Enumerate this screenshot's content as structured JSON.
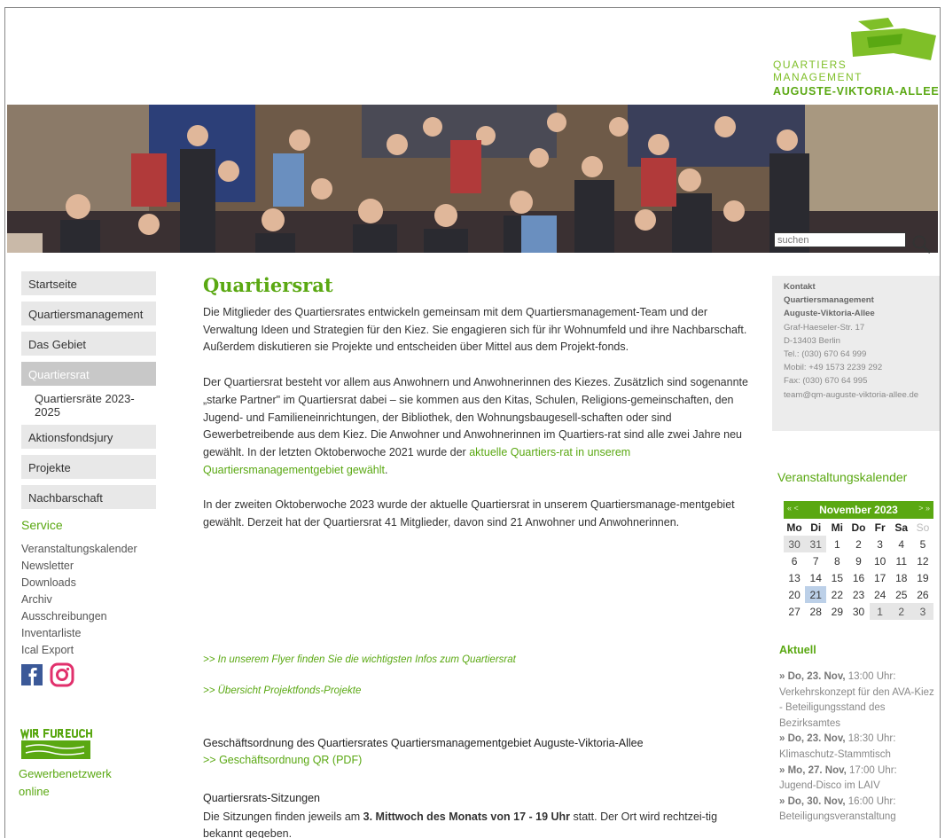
{
  "header": {
    "logo_line1": "QUARTIERS",
    "logo_line2": "MANAGEMENT",
    "logo_line3": "AUGUSTE-VIKTORIA-ALLEE",
    "search_placeholder": "suchen"
  },
  "nav": {
    "items": [
      {
        "label": "Startseite"
      },
      {
        "label": "Quartiersmanagement"
      },
      {
        "label": "Das Gebiet"
      },
      {
        "label": "Quartiersrat"
      },
      {
        "label": "Aktionsfondsjury"
      },
      {
        "label": "Projekte"
      },
      {
        "label": "Nachbarschaft"
      }
    ],
    "sub_item": "Quartiersräte 2023-2025"
  },
  "service": {
    "title": "Service",
    "links": [
      "Veranstaltungskalender",
      "Newsletter",
      "Downloads",
      "Archiv",
      "Ausschreibungen",
      "Inventarliste",
      "Ical Export"
    ],
    "gewerbe_line1": "Gewerbenetzwerk",
    "gewerbe_line2": "online"
  },
  "main": {
    "title": "Quartiersrat",
    "p1": "Die Mitglieder des Quartiersrates entwickeln gemeinsam mit dem Quartiersmanagement-Team und der Verwaltung Ideen und Strategien für den Kiez. Sie engagieren sich für ihr Wohnumfeld und ihre Nachbarschaft. Außerdem diskutieren sie Projekte und entscheiden über Mittel aus dem Projekt-fonds.",
    "p2_text": "Der Quartiersrat besteht vor allem aus Anwohnern und Anwohnerinnen des Kiezes. Zusätzlich sind sogenannte „starke Partner\" im Quartiersrat dabei – sie kommen aus den Kitas, Schulen, Religions-gemeinschaften, den Jugend- und Familieneinrichtungen, der Bibliothek, den Wohnungsbaugesell-schaften oder sind Gewerbetreibende aus dem Kiez. Die Anwohner und Anwohnerinnen im Quartiers-rat sind alle zwei Jahre neu gewählt. In der letzten Oktoberwoche 2021 wurde der ",
    "p2_link": "aktuelle Quartiers-rat in unserem Quartiersmanagementgebiet gewählt",
    "p2_end": ".",
    "p3": "In der zweiten Oktoberwoche 2023 wurde der aktuelle Quartiersrat in unserem Quartiersmanage-mentgebiet gewählt. Derzeit hat der Quartiersrat 41 Mitglieder, davon sind 21 Anwohner und Anwohnerinnen.",
    "flyer_link": ">> In unserem Flyer finden Sie die wichtigsten Infos zum Quartiersrat",
    "projects_link": ">> Übersicht Projektfonds-Projekte",
    "gesch_title": "Geschäftsordnung des Quartiersrates Quartiersmanagementgebiet Auguste-Viktoria-Allee",
    "gesch_link": ">> Geschäftsordnung QR (PDF)",
    "sitz_title": "Quartiersrats-Sitzungen",
    "sitz_pre": "Die Sitzungen finden jeweils am ",
    "sitz_bold": "3. Mittwoch des Monats von 17 - 19 Uhr",
    "sitz_post": " statt. Der Ort wird rechtzei-tig bekannt gegeben."
  },
  "contact": {
    "title": "Kontakt",
    "org1": "Quartiersmanagement",
    "org2": "Auguste-Viktoria-Allee",
    "street": "Graf-Haeseler-Str. 17",
    "city": "D-13403 Berlin",
    "tel": "Tel.: (030) 670 64 999",
    "mobil": "Mobil: +49 1573 2239 292",
    "fax": "Fax: (030) 670 64 995",
    "email": "team@qm-auguste-viktoria-allee.de"
  },
  "calendar": {
    "title": "Veranstaltungskalender",
    "prev": "« <",
    "next": "> »",
    "month": "November 2023",
    "weekdays": [
      "Mo",
      "Di",
      "Mi",
      "Do",
      "Fr",
      "Sa",
      "So"
    ],
    "weeks": [
      [
        "30",
        "31",
        "1",
        "2",
        "3",
        "4",
        "5"
      ],
      [
        "6",
        "7",
        "8",
        "9",
        "10",
        "11",
        "12"
      ],
      [
        "13",
        "14",
        "15",
        "16",
        "17",
        "18",
        "19"
      ],
      [
        "20",
        "21",
        "22",
        "23",
        "24",
        "25",
        "26"
      ],
      [
        "27",
        "28",
        "29",
        "30",
        "1",
        "2",
        "3"
      ]
    ]
  },
  "aktuell": {
    "title": "Aktuell",
    "events": [
      {
        "date": "» Do, 23. Nov,",
        "time": " 13:00 Uhr:",
        "text": "Verkehrskonzept für den AVA-Kiez - Beteiligungsstand des Bezirksamtes"
      },
      {
        "date": "» Do, 23. Nov,",
        "time": " 18:30 Uhr:",
        "text": "Klimaschutz-Stammtisch"
      },
      {
        "date": "» Mo, 27. Nov,",
        "time": " 17:00 Uhr:",
        "text": "Jugend-Disco im LAIV"
      },
      {
        "date": "» Do, 30. Nov,",
        "time": " 16:00 Uhr:",
        "text": "Beteiligungsveranstaltung"
      }
    ]
  },
  "colors": {
    "accent": "#5aa812",
    "logo_green": "#7fbf28",
    "nav_bg": "#e8e8e8"
  }
}
